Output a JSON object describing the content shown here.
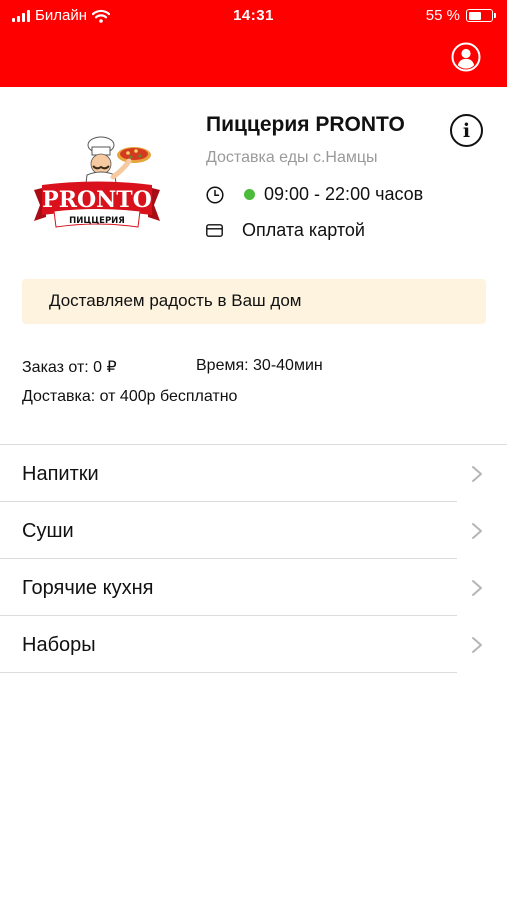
{
  "status_bar": {
    "carrier": "Билайн",
    "time": "14:31",
    "battery_text": "55 %",
    "battery_level": 0.55
  },
  "header": {
    "background_color": "#ff0000",
    "profile_icon": "user-circle-icon"
  },
  "restaurant": {
    "logo": {
      "brand_text": "PRONTO",
      "caption_text": "ПИЦЦЕРИЯ"
    },
    "name": "Пиццерия PRONTO",
    "info_icon_label": "i",
    "subtitle": "Доставка еды с.Намцы",
    "hours": "09:00 - 22:00 часов",
    "open_status_color": "#4cbb3c",
    "payment": "Оплата картой"
  },
  "banner": {
    "text": "Доставляем радость в Ваш дом",
    "background_color": "#fdf3de"
  },
  "order_info": {
    "min_order": "Заказ от: 0 ₽",
    "time": "Время: 30-40мин",
    "delivery": "Доставка: от 400р бесплатно"
  },
  "categories": [
    {
      "label": "Напитки"
    },
    {
      "label": "Суши"
    },
    {
      "label": "Горячие кухня"
    },
    {
      "label": "Наборы"
    }
  ]
}
